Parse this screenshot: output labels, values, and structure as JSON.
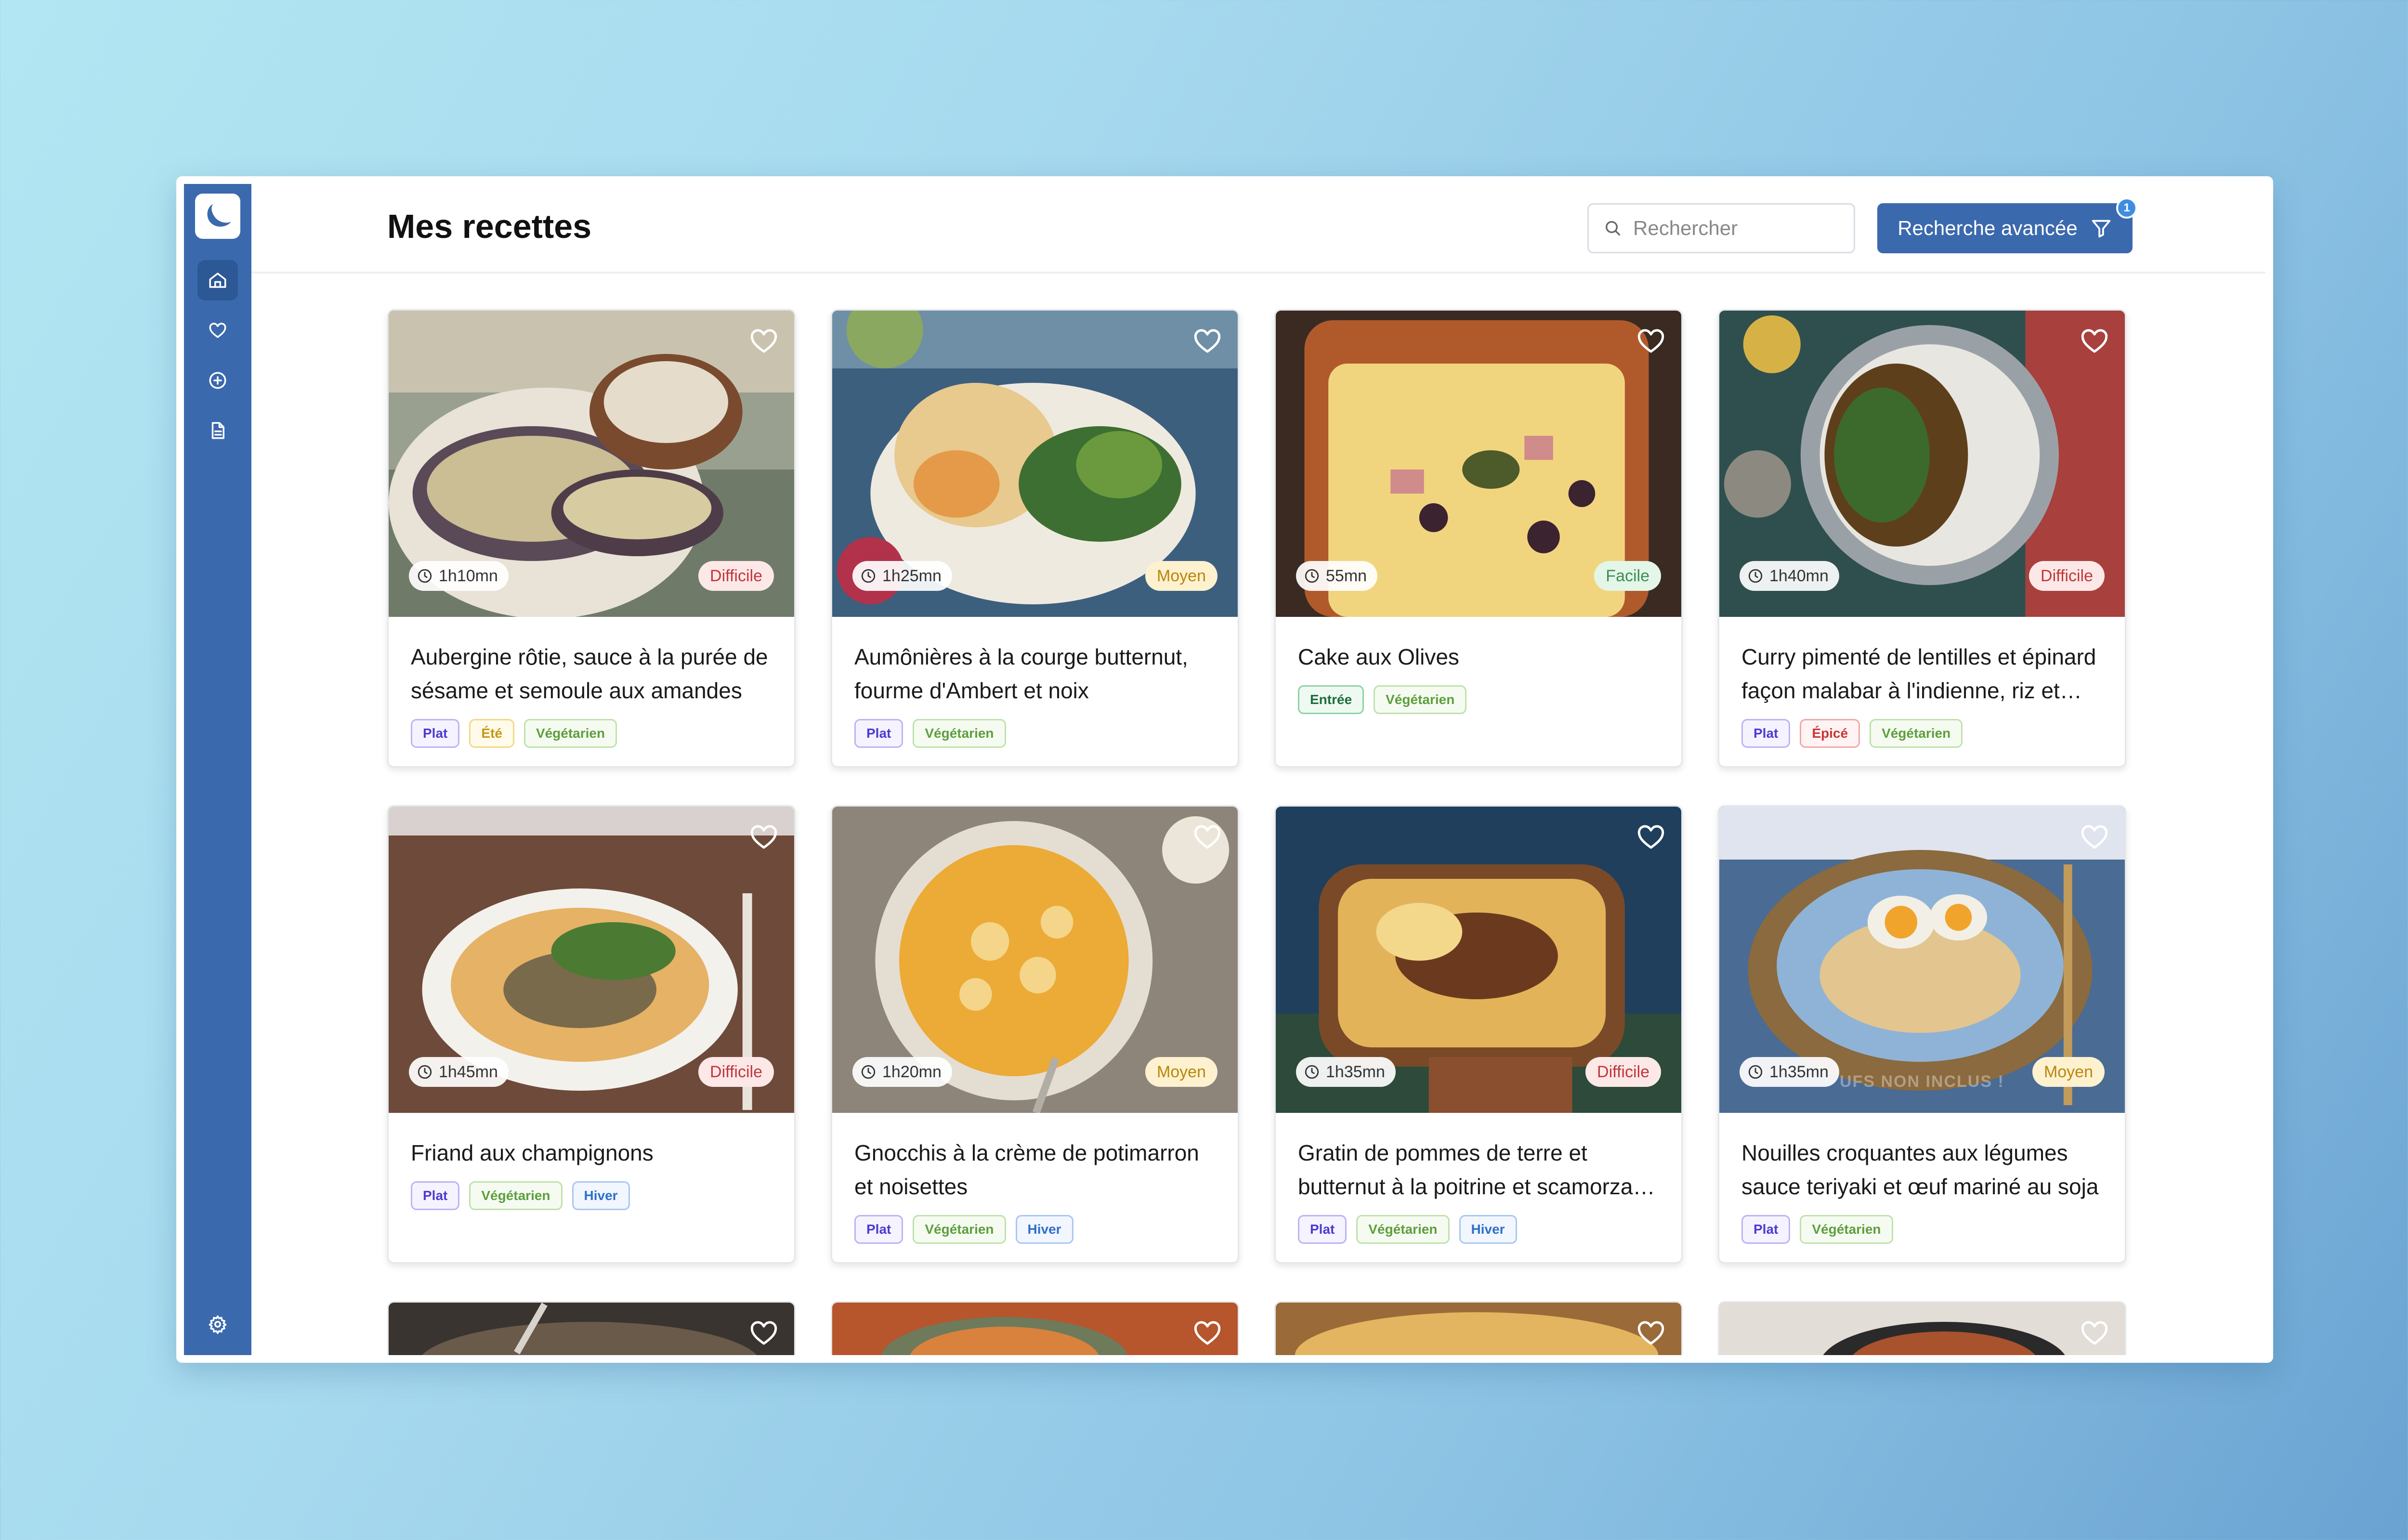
{
  "header": {
    "title": "Mes recettes",
    "search_placeholder": "Rechercher",
    "advanced_label": "Recherche avancée",
    "filter_count": "1"
  },
  "sidebar": {
    "items": [
      {
        "name": "home",
        "icon": "home-icon",
        "active": true
      },
      {
        "name": "favorites",
        "icon": "heart-icon",
        "active": false
      },
      {
        "name": "add",
        "icon": "plus-circle-icon",
        "active": false
      },
      {
        "name": "documents",
        "icon": "document-icon",
        "active": false
      }
    ],
    "settings_icon": "gear-icon"
  },
  "recipes": [
    {
      "title": "Aubergine rôtie, sauce à la purée de sésame et semoule aux amandes",
      "time": "1h10mn",
      "difficulty": "Difficile",
      "tags": [
        "Plat",
        "Été",
        "Végétarien"
      ]
    },
    {
      "title": "Aumônières à la courge butternut, fourme d'Ambert et noix",
      "time": "1h25mn",
      "difficulty": "Moyen",
      "tags": [
        "Plat",
        "Végétarien"
      ]
    },
    {
      "title": "Cake aux Olives",
      "time": "55mn",
      "difficulty": "Facile",
      "tags": [
        "Entrée",
        "Végétarien"
      ]
    },
    {
      "title": "Curry pimenté de lentilles et épinard façon malabar à l'indienne, riz et coriandre",
      "time": "1h40mn",
      "difficulty": "Difficile",
      "tags": [
        "Plat",
        "Épicé",
        "Végétarien"
      ]
    },
    {
      "title": "Friand aux champignons",
      "time": "1h45mn",
      "difficulty": "Difficile",
      "tags": [
        "Plat",
        "Végétarien",
        "Hiver"
      ]
    },
    {
      "title": "Gnocchis à la crème de potimarron et noisettes",
      "time": "1h20mn",
      "difficulty": "Moyen",
      "tags": [
        "Plat",
        "Végétarien",
        "Hiver"
      ]
    },
    {
      "title": "Gratin de pommes de terre et butternut à la poitrine et scamorza fumée",
      "time": "1h35mn",
      "difficulty": "Difficile",
      "tags": [
        "Plat",
        "Végétarien",
        "Hiver"
      ]
    },
    {
      "title": "Nouilles croquantes aux légumes sauce teriyaki et œuf mariné au soja",
      "time": "1h35mn",
      "difficulty": "Moyen",
      "tags": [
        "Plat",
        "Végétarien"
      ],
      "watermark": "UFS NON INCLUS !"
    }
  ],
  "colors": {
    "sidebar": "#3b69ad",
    "accent": "#3b69ad",
    "difficile": "#c0373a",
    "moyen": "#b9860c",
    "facile": "#3e8e53"
  }
}
